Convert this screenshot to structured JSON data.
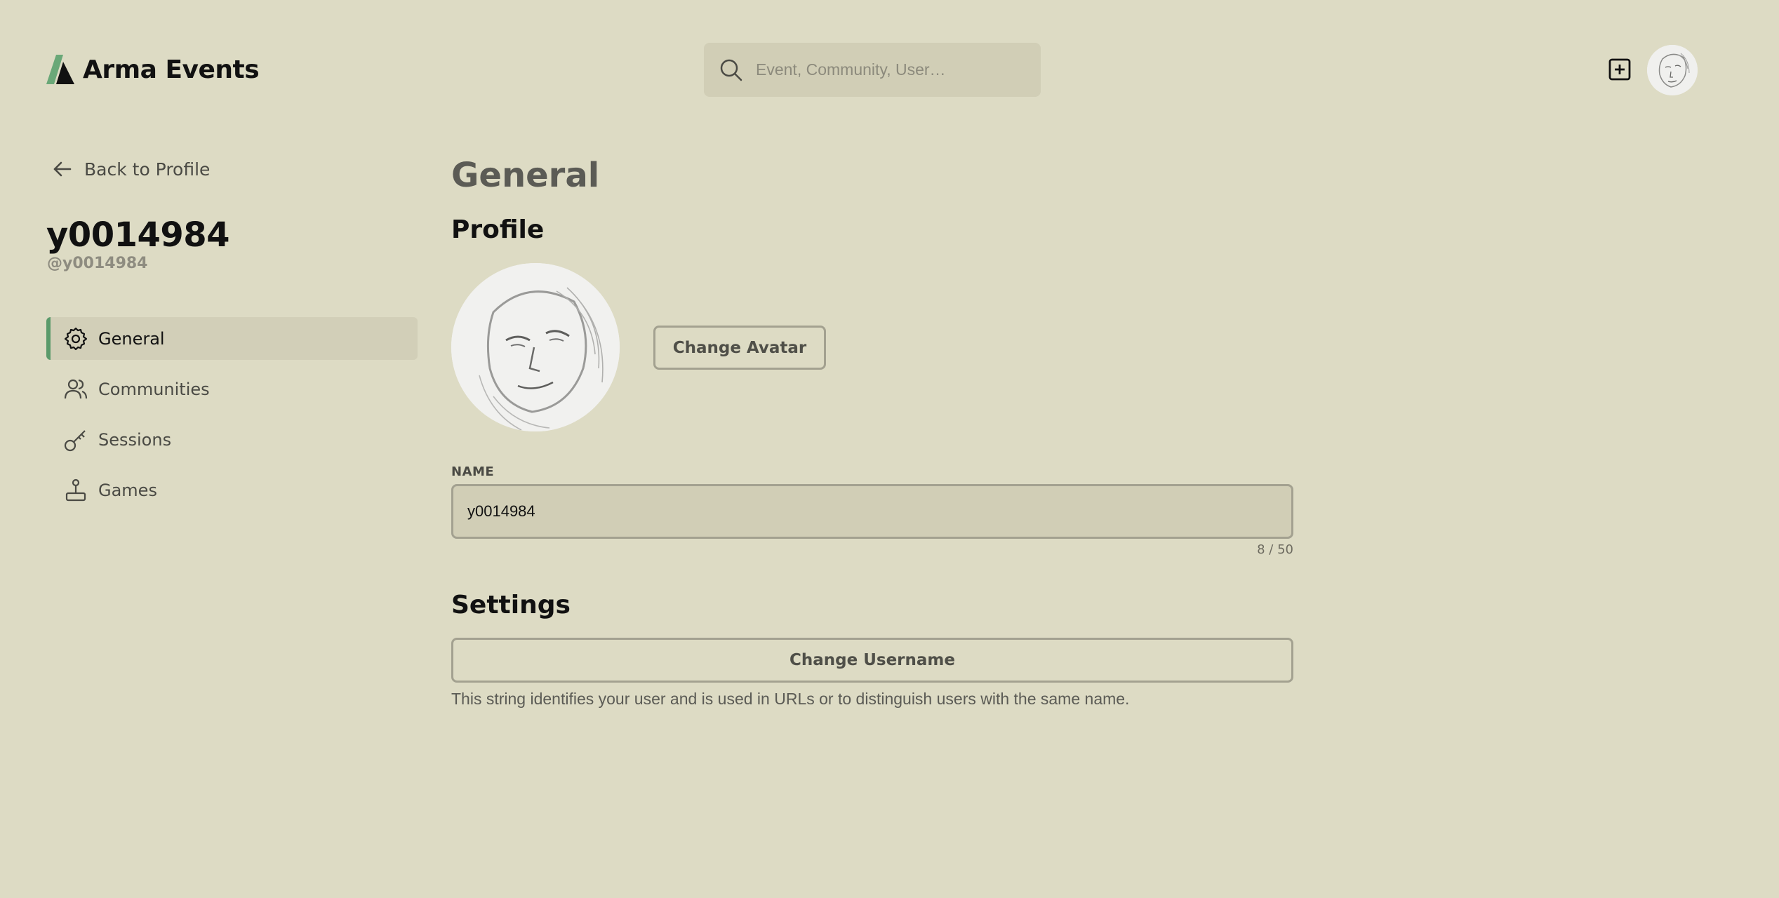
{
  "brand": {
    "name": "Arma Events",
    "accent_color": "#5a9a6a",
    "background_color": "#dddbc4"
  },
  "header": {
    "search": {
      "placeholder": "Event, Community, User…",
      "icon": "search-icon"
    },
    "create_icon": "plus-square-icon",
    "avatar": "user-avatar"
  },
  "sidebar": {
    "back_label": "Back to Profile",
    "user_name": "y0014984",
    "user_handle": "@y0014984",
    "items": [
      {
        "label": "General",
        "icon": "gear-icon",
        "active": true
      },
      {
        "label": "Communities",
        "icon": "users-icon",
        "active": false
      },
      {
        "label": "Sessions",
        "icon": "key-icon",
        "active": false
      },
      {
        "label": "Games",
        "icon": "joystick-icon",
        "active": false
      }
    ]
  },
  "main": {
    "title": "General",
    "profile": {
      "heading": "Profile",
      "change_avatar_label": "Change Avatar",
      "name_label": "NAME",
      "name_value": "y0014984",
      "name_counter": "8 / 50"
    },
    "settings": {
      "heading": "Settings",
      "change_username_label": "Change Username",
      "help_text": "This string identifies your user and is used in URLs or to distinguish users with the same name."
    }
  }
}
